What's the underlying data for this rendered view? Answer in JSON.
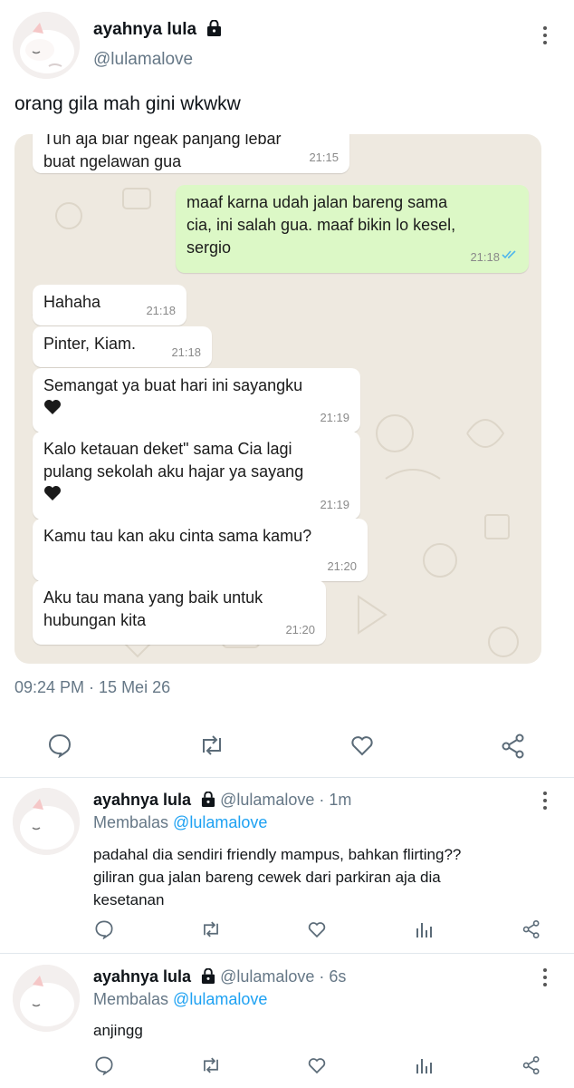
{
  "main_tweet": {
    "author_name": "ayahnya lula",
    "handle": "@lulamalove",
    "text": "orang gila mah gini wkwkw",
    "timestamp": "09:24 PM · 15 Mei 26"
  },
  "chat": {
    "top_partial": {
      "line1": "Tuh aja biar ngeak panjang lebar",
      "line2": "buat ngelawan gua",
      "time": "21:15"
    },
    "messages": [
      {
        "dir": "out",
        "lines": [
          "maaf karna udah jalan bareng sama",
          "cia, ini salah gua. maaf bikin lo kesel,",
          "sergio"
        ],
        "time": "21:18"
      },
      {
        "dir": "in",
        "lines": [
          "Hahaha"
        ],
        "time": "21:18"
      },
      {
        "dir": "in",
        "lines": [
          "Pinter, Kiam."
        ],
        "time": "21:18"
      },
      {
        "dir": "in",
        "lines": [
          "Semangat ya buat hari ini sayangku"
        ],
        "time": "21:19"
      },
      {
        "dir": "in",
        "lines": [
          "Kalo ketauan deket\" sama Cia lagi",
          "pulang sekolah aku hajar ya sayang"
        ],
        "time": "21:19"
      },
      {
        "dir": "in",
        "lines": [
          "Kamu tau kan aku cinta sama kamu?"
        ],
        "time": "21:20"
      },
      {
        "dir": "in",
        "lines": [
          "Aku tau mana yang baik untuk",
          "hubungan kita"
        ],
        "time": "21:20"
      }
    ]
  },
  "replies": [
    {
      "author_name": "ayahnya lula",
      "meta": "@lulamalove · 1m",
      "replying_label": "Membalas",
      "replying_to": "@lulamalove",
      "lines": [
        "padahal dia sendiri friendly mampus, bahkan flirting??",
        "giliran gua jalan bareng cewek dari parkiran aja dia",
        "kesetanan"
      ]
    },
    {
      "author_name": "ayahnya lula",
      "meta": "@lulamalove · 6s",
      "replying_label": "Membalas",
      "replying_to": "@lulamalove",
      "lines": [
        "anjingg"
      ]
    }
  ],
  "icons": {
    "reply": "comment-icon",
    "retweet": "retweet-icon",
    "like": "heart-icon",
    "analytics": "bar-chart-icon",
    "share": "share-icon",
    "more": "more-vertical-icon",
    "lock": "lock-icon"
  },
  "colors": {
    "link": "#1da1f2",
    "muted": "#657786",
    "bubble_out": "#dcf8c6",
    "chat_bg": "#eee9e0"
  }
}
